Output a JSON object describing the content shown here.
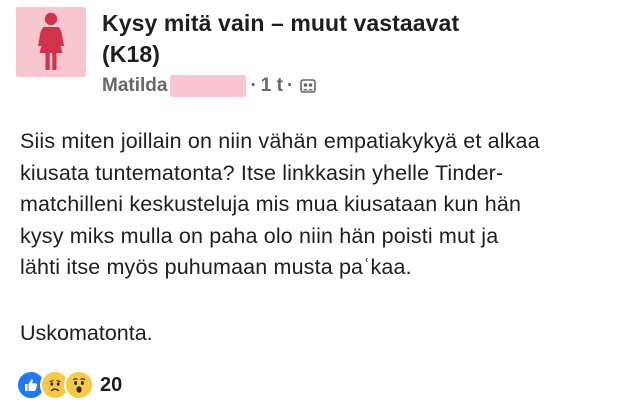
{
  "post": {
    "group_title_line1": "Kysy mitä vain – muut vastaavat",
    "group_title_line2": "(K18)",
    "author_name": "Matilda",
    "separator": "·",
    "time": "1 t",
    "body_lines": [
      "Siis miten joillain on niin vähän empatiakykyä et alkaa",
      "kiusata tuntematonta? Itse linkkasin yhelle Tinder-",
      "matchilleni keskusteluja mis mua kiusataan kun hän",
      "kysy miks mulla on paha olo niin hän poisti mut ja",
      "lähti itse myös puhumaan musta paʿkaa."
    ],
    "closing": "Uskomatonta.",
    "reactions": {
      "types": [
        "like-icon",
        "sad-icon",
        "wow-icon"
      ],
      "count": "20"
    }
  },
  "colors": {
    "avatar_bg": "#f8c6cf",
    "avatar_figure": "#d2334a",
    "redaction": "#fbc5d1",
    "like_blue": "#2078f4",
    "reaction_yellow": "#f7c948",
    "meta_gray": "#65676b",
    "text": "#1c1e21"
  }
}
